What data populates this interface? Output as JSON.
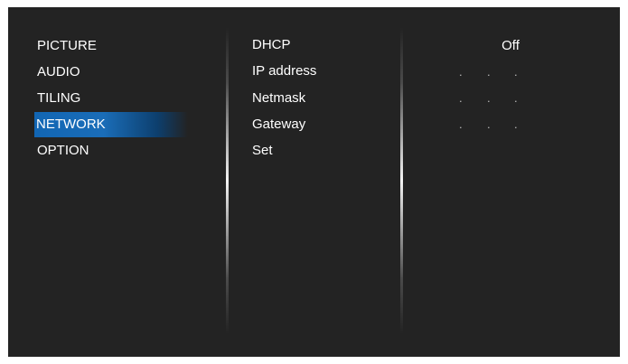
{
  "main_menu": {
    "items": [
      {
        "label": "PICTURE",
        "selected": false
      },
      {
        "label": "AUDIO",
        "selected": false
      },
      {
        "label": "TILING",
        "selected": false
      },
      {
        "label": "NETWORK",
        "selected": true
      },
      {
        "label": "OPTION",
        "selected": false
      }
    ]
  },
  "network_menu": {
    "items": [
      {
        "label": "DHCP"
      },
      {
        "label": "IP address"
      },
      {
        "label": "Netmask"
      },
      {
        "label": "Gateway"
      },
      {
        "label": "Set"
      }
    ]
  },
  "values": {
    "dhcp": "Off",
    "ip_address": ". . .",
    "netmask": ". . .",
    "gateway": ". . ."
  },
  "colors": {
    "background": "#232323",
    "selection": "#1a6db8",
    "text": "#ffffff"
  }
}
